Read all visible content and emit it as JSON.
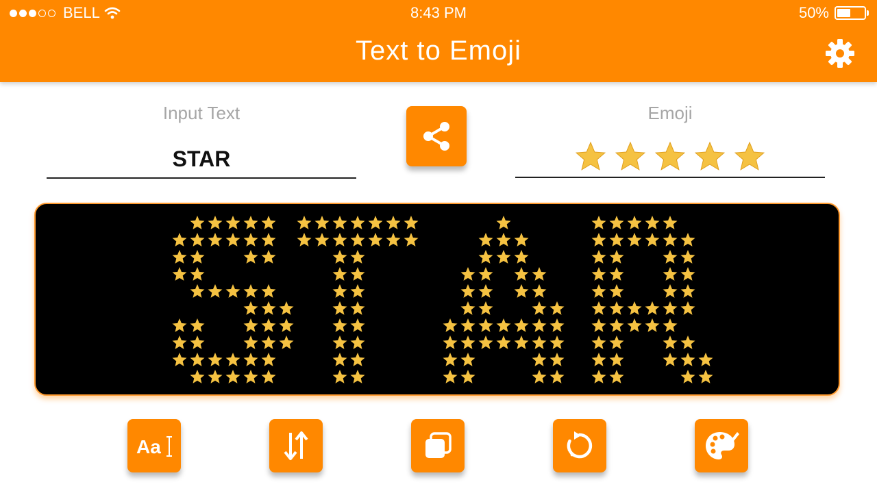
{
  "status_bar": {
    "carrier": "BELL",
    "time": "8:43 PM",
    "battery": "50%",
    "battery_level": 0.5,
    "signal_bars_filled": 3,
    "signal_bars_total": 5
  },
  "app": {
    "title": "Text to Emoji",
    "accent_color": "#ff8800"
  },
  "input": {
    "label": "Input Text",
    "value": "STAR"
  },
  "output": {
    "label": "Emoji",
    "emoji": "star",
    "count": 5,
    "color": "#f5c242"
  },
  "art": {
    "text": "STAR",
    "background": "#000000",
    "star_color": "#f5c242"
  },
  "icons": {
    "settings": "gear-icon",
    "share": "share-icon",
    "font": "font-icon",
    "flip": "swap-vertical-icon",
    "copy": "copy-icon",
    "reset": "rotate-icon",
    "palette": "palette-icon"
  },
  "toolbar": {
    "font_glyph": "Aa"
  }
}
